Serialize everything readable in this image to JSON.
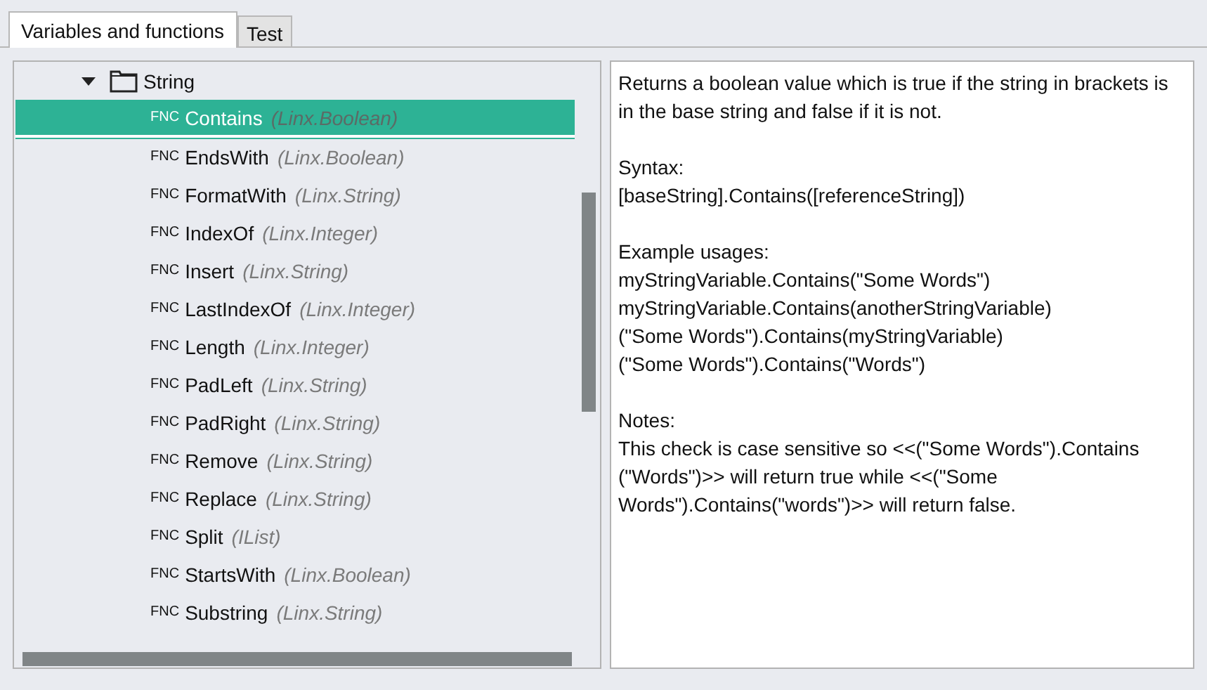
{
  "tabs": [
    {
      "label": "Variables and functions",
      "selected": true
    },
    {
      "label": "Test",
      "selected": false
    }
  ],
  "tree": {
    "folder": {
      "label": "String",
      "expanded": true,
      "children": [
        {
          "tag": "FNC",
          "name": "Contains",
          "type": "(Linx.Boolean)",
          "selected": true
        },
        {
          "tag": "FNC",
          "name": "EndsWith",
          "type": "(Linx.Boolean)",
          "selected": false
        },
        {
          "tag": "FNC",
          "name": "FormatWith",
          "type": "(Linx.String)",
          "selected": false
        },
        {
          "tag": "FNC",
          "name": "IndexOf",
          "type": "(Linx.Integer)",
          "selected": false
        },
        {
          "tag": "FNC",
          "name": "Insert",
          "type": "(Linx.String)",
          "selected": false
        },
        {
          "tag": "FNC",
          "name": "LastIndexOf",
          "type": "(Linx.Integer)",
          "selected": false
        },
        {
          "tag": "FNC",
          "name": "Length",
          "type": "(Linx.Integer)",
          "selected": false
        },
        {
          "tag": "FNC",
          "name": "PadLeft",
          "type": "(Linx.String)",
          "selected": false
        },
        {
          "tag": "FNC",
          "name": "PadRight",
          "type": "(Linx.String)",
          "selected": false
        },
        {
          "tag": "FNC",
          "name": "Remove",
          "type": "(Linx.String)",
          "selected": false
        },
        {
          "tag": "FNC",
          "name": "Replace",
          "type": "(Linx.String)",
          "selected": false
        },
        {
          "tag": "FNC",
          "name": "Split",
          "type": "(IList)",
          "selected": false
        },
        {
          "tag": "FNC",
          "name": "StartsWith",
          "type": "(Linx.Boolean)",
          "selected": false
        },
        {
          "tag": "FNC",
          "name": "Substring",
          "type": "(Linx.String)",
          "selected": false
        }
      ]
    }
  },
  "description": [
    [
      "Returns a boolean value which is true if the string in brackets is in the base string and false if it is not."
    ],
    [
      "Syntax:",
      "[baseString].Contains([referenceString])"
    ],
    [
      "Example usages:",
      "myStringVariable.Contains(\"Some Words\")",
      "myStringVariable.Contains(anotherStringVariable)",
      "(\"Some Words\").Contains(myStringVariable)",
      "(\"Some Words\").Contains(\"Words\")"
    ],
    [
      "Notes:",
      "This check is case sensitive so <<(\"Some Words\").Contains (\"Words\")>> will return true while <<(\"Some Words\").Contains(\"words\")>> will return false."
    ]
  ]
}
